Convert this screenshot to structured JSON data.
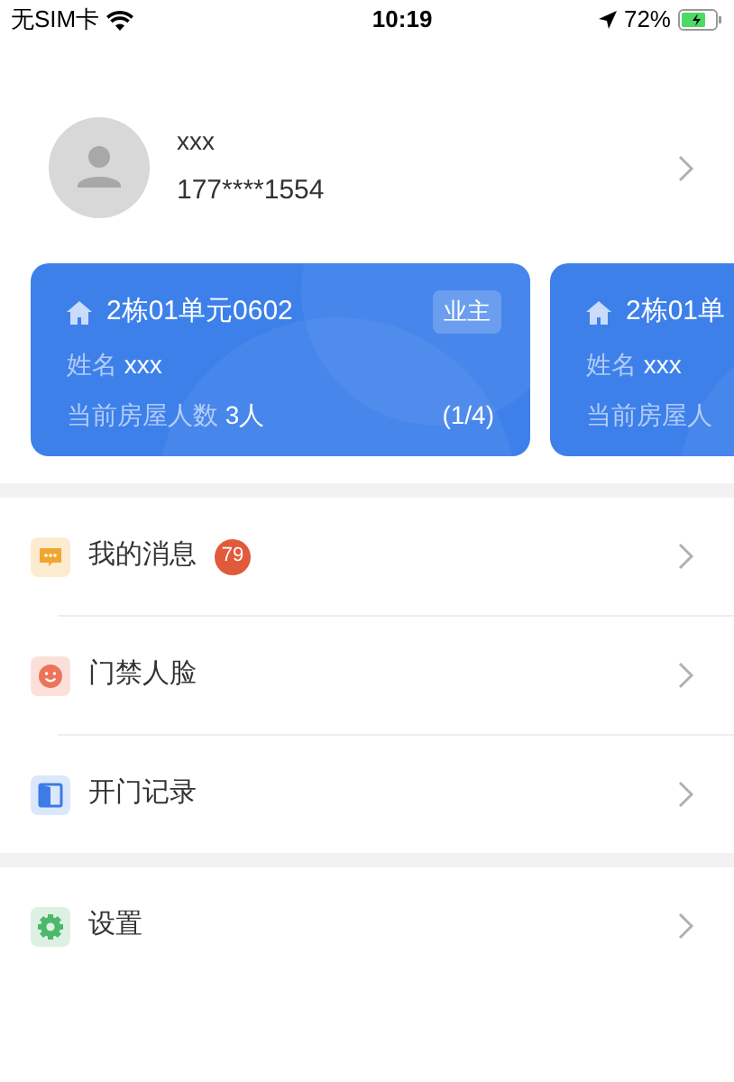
{
  "status_bar": {
    "carrier": "无SIM卡",
    "time": "10:19",
    "battery": "72%"
  },
  "profile": {
    "name": "xxx",
    "phone": "177****1554"
  },
  "houses": [
    {
      "title": "2栋01单元0602",
      "role": "业主",
      "name_label": "姓名",
      "name": "xxx",
      "count_label": "当前房屋人数",
      "count": "3人",
      "page": "(1/4)"
    },
    {
      "title": "2栋01单",
      "name_label": "姓名",
      "name": "xxx",
      "count_label": "当前房屋人"
    }
  ],
  "menu_groups": [
    [
      {
        "kind": "message",
        "label": "我的消息",
        "badge": "79"
      },
      {
        "kind": "face",
        "label": "门禁人脸"
      },
      {
        "kind": "door",
        "label": "开门记录"
      }
    ],
    [
      {
        "kind": "settings",
        "label": "设置"
      }
    ]
  ]
}
